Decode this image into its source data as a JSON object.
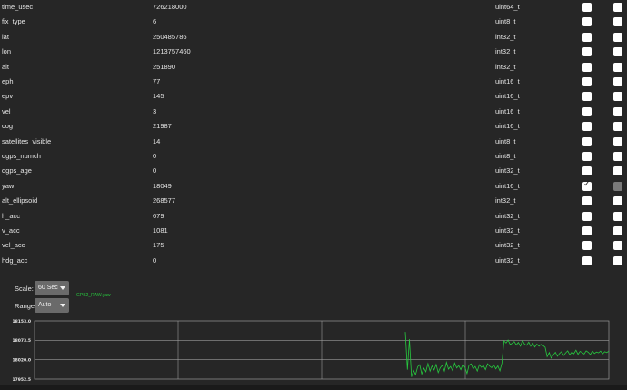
{
  "fields": [
    {
      "name": "time_usec",
      "value": "726218000",
      "type": "uint64_t",
      "plot": false,
      "enabled": true
    },
    {
      "name": "fix_type",
      "value": "6",
      "type": "uint8_t",
      "plot": false,
      "enabled": true
    },
    {
      "name": "lat",
      "value": "250485786",
      "type": "int32_t",
      "plot": false,
      "enabled": true
    },
    {
      "name": "lon",
      "value": "1213757460",
      "type": "int32_t",
      "plot": false,
      "enabled": true
    },
    {
      "name": "alt",
      "value": "251890",
      "type": "int32_t",
      "plot": false,
      "enabled": true
    },
    {
      "name": "eph",
      "value": "77",
      "type": "uint16_t",
      "plot": false,
      "enabled": true
    },
    {
      "name": "epv",
      "value": "145",
      "type": "uint16_t",
      "plot": false,
      "enabled": true
    },
    {
      "name": "vel",
      "value": "3",
      "type": "uint16_t",
      "plot": false,
      "enabled": true
    },
    {
      "name": "cog",
      "value": "21987",
      "type": "uint16_t",
      "plot": false,
      "enabled": true
    },
    {
      "name": "satellites_visible",
      "value": "14",
      "type": "uint8_t",
      "plot": false,
      "enabled": true
    },
    {
      "name": "dgps_numch",
      "value": "0",
      "type": "uint8_t",
      "plot": false,
      "enabled": true
    },
    {
      "name": "dgps_age",
      "value": "0",
      "type": "uint32_t",
      "plot": false,
      "enabled": true
    },
    {
      "name": "yaw",
      "value": "18049",
      "type": "uint16_t",
      "plot": true,
      "enabled": false
    },
    {
      "name": "alt_ellipsoid",
      "value": "268577",
      "type": "int32_t",
      "plot": false,
      "enabled": true
    },
    {
      "name": "h_acc",
      "value": "679",
      "type": "uint32_t",
      "plot": false,
      "enabled": true
    },
    {
      "name": "v_acc",
      "value": "1081",
      "type": "uint32_t",
      "plot": false,
      "enabled": true
    },
    {
      "name": "vel_acc",
      "value": "175",
      "type": "uint32_t",
      "plot": false,
      "enabled": true
    },
    {
      "name": "hdg_acc",
      "value": "0",
      "type": "uint32_t",
      "plot": false,
      "enabled": true
    }
  ],
  "controls": {
    "scale_label": "Scale:",
    "scale_value": "60 Sec",
    "range_label": "Range:",
    "range_value": "Auto"
  },
  "colors": {
    "series": "#27c93f",
    "grid": "#9a9a9a",
    "background": "#262626"
  },
  "chart_data": {
    "type": "line",
    "series": [
      {
        "name": "GPS2_RAW.yaw",
        "values": [
          18115,
          17985,
          18090,
          17960,
          17982,
          17968,
          17995,
          18002,
          17970,
          17990,
          17978,
          18006,
          17980,
          17998,
          17984,
          18003,
          17975,
          17992,
          18000,
          17980,
          18010,
          17987,
          17996,
          17982,
          18008,
          17991,
          17999,
          17985,
          18004,
          17993,
          17972,
          18000,
          18005,
          17988,
          17996,
          17980,
          18002,
          17993,
          17999,
          17985,
          18005,
          17997,
          17992,
          18001,
          17988,
          17998,
          17981,
          18007,
          18084,
          18077,
          18087,
          18072,
          18076,
          18082,
          18070,
          18079,
          18066,
          18085,
          18073,
          18069,
          18080,
          18066,
          18076,
          18063,
          18073,
          18066,
          18072,
          18068,
          18062,
          18030,
          18044,
          18025,
          18036,
          18045,
          18031,
          18041,
          18047,
          18034,
          18043,
          18050,
          18036,
          18046,
          18040,
          18052,
          18038,
          18048,
          18044,
          18039,
          18050,
          18045,
          18037,
          18049,
          18041,
          18046,
          18043,
          18049,
          18040,
          18047,
          18044,
          18049
        ]
      }
    ],
    "y_ticks": [
      "18153.0",
      "18073.5",
      "18020.0",
      "17952.5"
    ],
    "ylim": [
      17952.5,
      18153.0
    ],
    "grid": true
  }
}
